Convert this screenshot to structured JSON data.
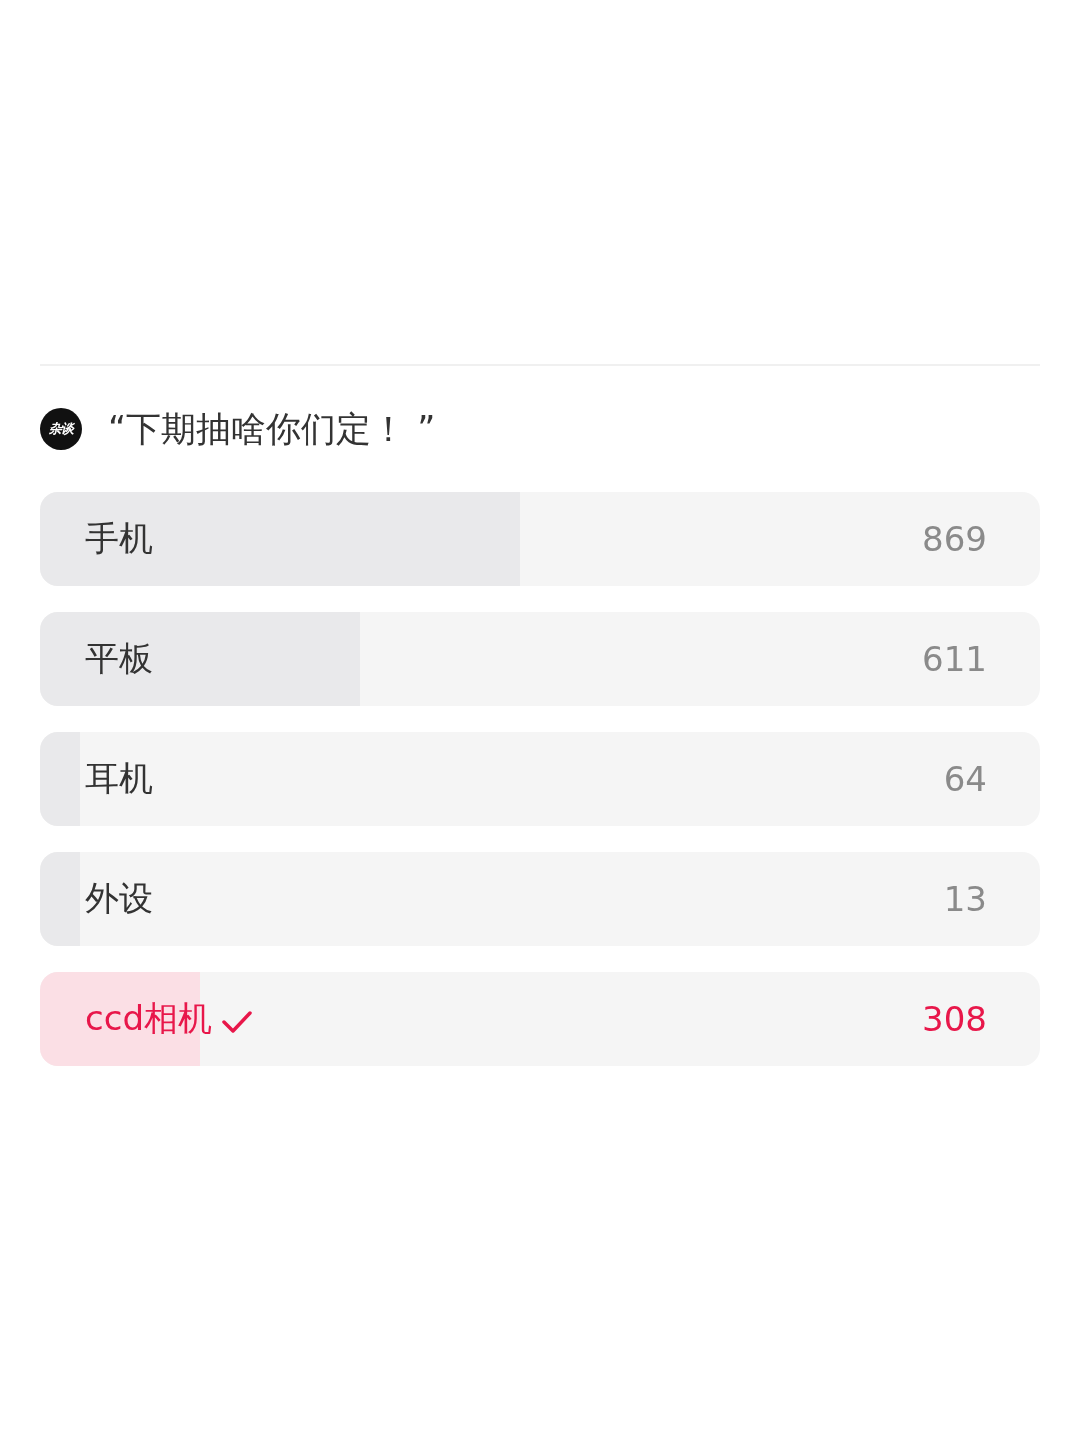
{
  "poll": {
    "badge": "杂谈",
    "title": "“下期抽啥你们定！ ”",
    "options": [
      {
        "label": "手机",
        "count": "869",
        "level": 0.48,
        "selected": false
      },
      {
        "label": "平板",
        "count": "611",
        "level": 0.32,
        "selected": false
      },
      {
        "label": "耳机",
        "count": "64",
        "level": 0.04,
        "selected": false
      },
      {
        "label": "外设",
        "count": "13",
        "level": 0.04,
        "selected": false
      },
      {
        "label": "ccd相机",
        "count": "308",
        "level": 0.16,
        "selected": true
      }
    ]
  }
}
